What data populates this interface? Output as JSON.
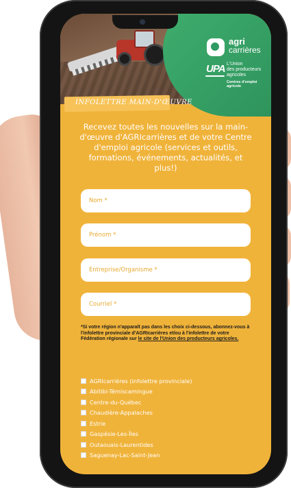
{
  "header": {
    "logo_agri": "agri",
    "logo_carrieres": "carrières",
    "upa_logo": "UPA",
    "upa_name_line1": "L'Union",
    "upa_name_line2": "des producteurs",
    "upa_name_line3": "agricoles",
    "upa_subtitle": "Centres d'emploi agricole"
  },
  "banner": "INFOLETTRE MAIN-D'ŒUVRE",
  "intro": "Recevez toutes les nouvelles sur la main-d'œuvre d'AGRIcarrières et de votre Centre d'emploi agricole (services et outils, formations, événements, actualités, et plus!)",
  "form": {
    "nom": {
      "placeholder": "Nom *"
    },
    "prenom": {
      "placeholder": "Prénom *"
    },
    "entreprise": {
      "placeholder": "Entreprise/Organisme *"
    },
    "courriel": {
      "placeholder": "Courriel *"
    }
  },
  "note": {
    "text": "*Si votre région n'apparaît pas dans les choix ci-dessous, abonnez-vous à l'infolettre provinciale d'AGRIcarrières et/ou à l'infolettre de votre Fédération régionale sur ",
    "link": "le site de l'Union des producteurs agricoles."
  },
  "regions": [
    "AGRIcarrières (infolettre provinciale)",
    "Abitibi-Témiscamingue",
    "Centre-du-Québec",
    "Chaudière-Appalaches",
    "Estrie",
    "Gaspésie-Les-Îles",
    "Outaouais-Laurentides",
    "Saguenay-Lac-Saint-Jean"
  ],
  "colors": {
    "background": "#f0b33a",
    "green": "#2f9a62"
  }
}
